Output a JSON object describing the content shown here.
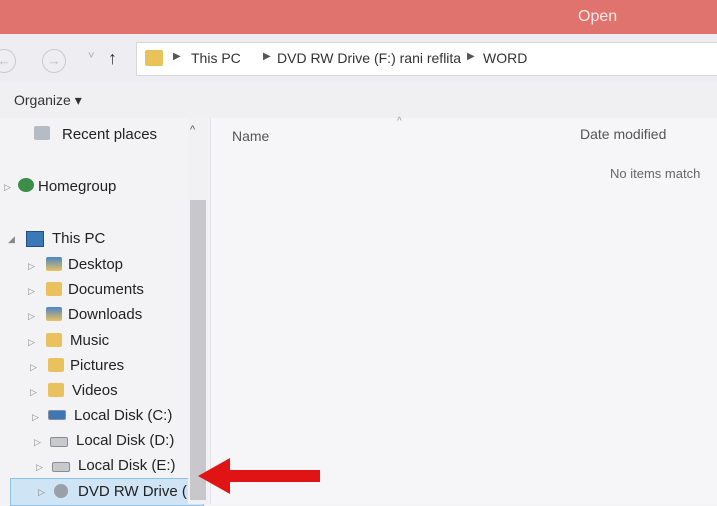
{
  "window": {
    "title": "Open"
  },
  "nav": {
    "back": "←",
    "forward": "→",
    "up": "↑",
    "dropdown": "˅"
  },
  "address": {
    "crumbs": [
      "This PC",
      "DVD RW Drive (F:) rani reflita",
      "WORD"
    ],
    "separator": "▶"
  },
  "toolbar": {
    "organize": "Organize ▾"
  },
  "sidebar": {
    "recent_places": "Recent places",
    "homegroup": "Homegroup",
    "this_pc": "This PC",
    "items": [
      {
        "label": "Desktop",
        "icon": "desktop-folder-icon"
      },
      {
        "label": "Documents",
        "icon": "documents-folder-icon"
      },
      {
        "label": "Downloads",
        "icon": "downloads-folder-icon"
      },
      {
        "label": "Music",
        "icon": "music-folder-icon"
      },
      {
        "label": "Pictures",
        "icon": "pictures-folder-icon"
      },
      {
        "label": "Videos",
        "icon": "videos-folder-icon"
      },
      {
        "label": "Local Disk (C:)",
        "icon": "local-disk-icon"
      },
      {
        "label": "Local Disk (D:)",
        "icon": "local-disk-icon"
      },
      {
        "label": "Local Disk (E:)",
        "icon": "local-disk-icon"
      },
      {
        "label": "DVD RW Drive (F:",
        "icon": "dvd-drive-icon"
      }
    ]
  },
  "content": {
    "columns": {
      "name": "Name",
      "date_modified": "Date modified"
    },
    "empty_message": "No items match"
  },
  "colors": {
    "titlebar": "#e0736d",
    "selection": "#cfe4f5",
    "annotation_arrow": "#e01414"
  }
}
